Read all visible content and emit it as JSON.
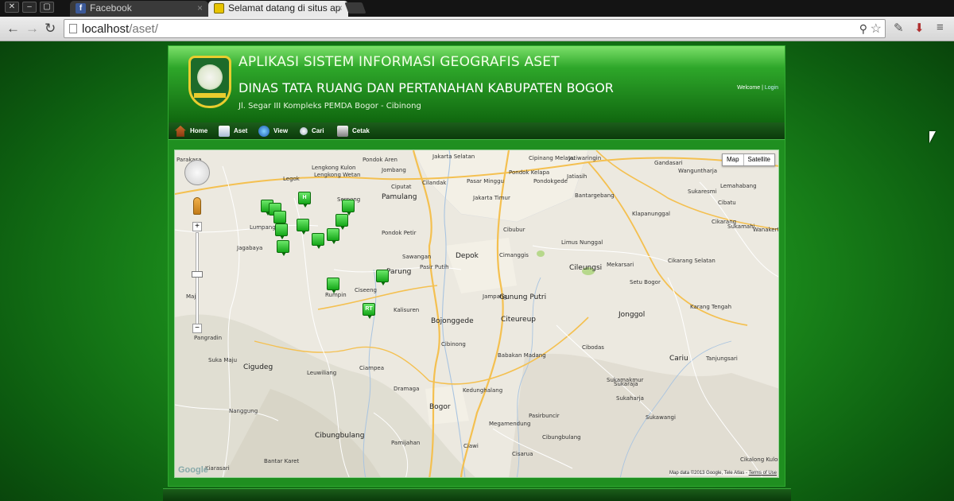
{
  "browser": {
    "tabs": [
      {
        "title": "Facebook",
        "favicon": "facebook-icon",
        "active": false
      },
      {
        "title": "Selamat datang di situs ap",
        "favicon": "bogor-logo-icon",
        "active": true
      }
    ],
    "url_host": "localhost",
    "url_path": "/aset/",
    "window_buttons": [
      "close-icon",
      "minimize-icon",
      "restore-icon"
    ]
  },
  "header": {
    "app_title": "APLIKASI SISTEM INFORMASI GEOGRAFIS ASET",
    "org_title": "DINAS TATA RUANG DAN PERTANAHAN KABUPATEN BOGOR",
    "address": "Jl. Segar III Kompleks PEMDA Bogor - Cibinong",
    "welcome": "Welcome",
    "separator": "|",
    "login": "Login"
  },
  "menu": [
    {
      "label": "Home",
      "icon": "home-icon"
    },
    {
      "label": "Aset",
      "icon": "document-icon"
    },
    {
      "label": "View",
      "icon": "globe-icon"
    },
    {
      "label": "Cari",
      "icon": "search-icon"
    },
    {
      "label": "Cetak",
      "icon": "printer-icon"
    }
  ],
  "map": {
    "type_buttons": [
      "Map",
      "Satellite"
    ],
    "google": "Google",
    "attribution": "Map data ©2013 Google, Tele Atlas - ",
    "terms": "Terms of Use",
    "places": [
      {
        "name": "Parakasa"
      },
      {
        "name": "Legok"
      },
      {
        "name": "Pondok Aren"
      },
      {
        "name": "Jakarta Selatan"
      },
      {
        "name": "Cipinang Melayu"
      },
      {
        "name": "Pondok Kelapa"
      },
      {
        "name": "Jatiwaringin"
      },
      {
        "name": "Gandasari"
      },
      {
        "name": "Wanguntharja"
      },
      {
        "name": "Lengkong Kulon"
      },
      {
        "name": "Lengkong Wetan"
      },
      {
        "name": "Jombang"
      },
      {
        "name": "Ciputat"
      },
      {
        "name": "Cilandak"
      },
      {
        "name": "Pasar Minggu"
      },
      {
        "name": "Pondokgede"
      },
      {
        "name": "Jatiasih"
      },
      {
        "name": "Bantargebang"
      },
      {
        "name": "Sukaresmi"
      },
      {
        "name": "Lemahabang"
      },
      {
        "name": "Cibatu"
      },
      {
        "name": "Pamulang"
      },
      {
        "name": "Jakarta Timur"
      },
      {
        "name": "Serpong"
      },
      {
        "name": "Pondok Petir"
      },
      {
        "name": "Cibubur"
      },
      {
        "name": "Limus Nunggal"
      },
      {
        "name": "Klapanunggal"
      },
      {
        "name": "Cikarang"
      },
      {
        "name": "Sukamahi"
      },
      {
        "name": "Wanakerta"
      },
      {
        "name": "Depok"
      },
      {
        "name": "Sawangan"
      },
      {
        "name": "Pasir Putih"
      },
      {
        "name": "Cimanggis"
      },
      {
        "name": "Cileungsi"
      },
      {
        "name": "Mekarsari"
      },
      {
        "name": "Cikarang Selatan"
      },
      {
        "name": "Setu Bogor"
      },
      {
        "name": "Karang Tengah"
      },
      {
        "name": "Parung"
      },
      {
        "name": "Jampang"
      },
      {
        "name": "Bojonggede"
      },
      {
        "name": "Citeureup"
      },
      {
        "name": "Gunung Putri"
      },
      {
        "name": "Jonggol"
      },
      {
        "name": "Rumpin"
      },
      {
        "name": "Ciseeng"
      },
      {
        "name": "Kalisuren"
      },
      {
        "name": "Cibodas"
      },
      {
        "name": "Cibinong"
      },
      {
        "name": "Babakan Madang"
      },
      {
        "name": "Sukamakmur"
      },
      {
        "name": "Cariu"
      },
      {
        "name": "Tanjungsari"
      },
      {
        "name": "Cigudeg"
      },
      {
        "name": "Leuwiliang"
      },
      {
        "name": "Ciampea"
      },
      {
        "name": "Dramaga"
      },
      {
        "name": "Kedunghalang"
      },
      {
        "name": "Bogor"
      },
      {
        "name": "Ciawi"
      },
      {
        "name": "Megamendung"
      },
      {
        "name": "Sukaharja"
      },
      {
        "name": "Nanggung"
      },
      {
        "name": "Cibungbulang"
      },
      {
        "name": "Pamijahan"
      },
      {
        "name": "Cisarua"
      },
      {
        "name": "Cibungbulang"
      },
      {
        "name": "Pasirbuncir"
      },
      {
        "name": "Sukaraja"
      },
      {
        "name": "Sukawangi"
      },
      {
        "name": "Bantar Karet"
      },
      {
        "name": "Cikalong Kulon"
      },
      {
        "name": "Kiarasari"
      },
      {
        "name": "Pangradin"
      },
      {
        "name": "Suka Maju"
      },
      {
        "name": "Jagabaya"
      },
      {
        "name": "Lumpang"
      },
      {
        "name": "Maja"
      }
    ],
    "markers": [
      "tower",
      "hospital",
      "building",
      "office",
      "plant",
      "bridge",
      "market",
      "school",
      "bus",
      "hall",
      "RT"
    ]
  }
}
